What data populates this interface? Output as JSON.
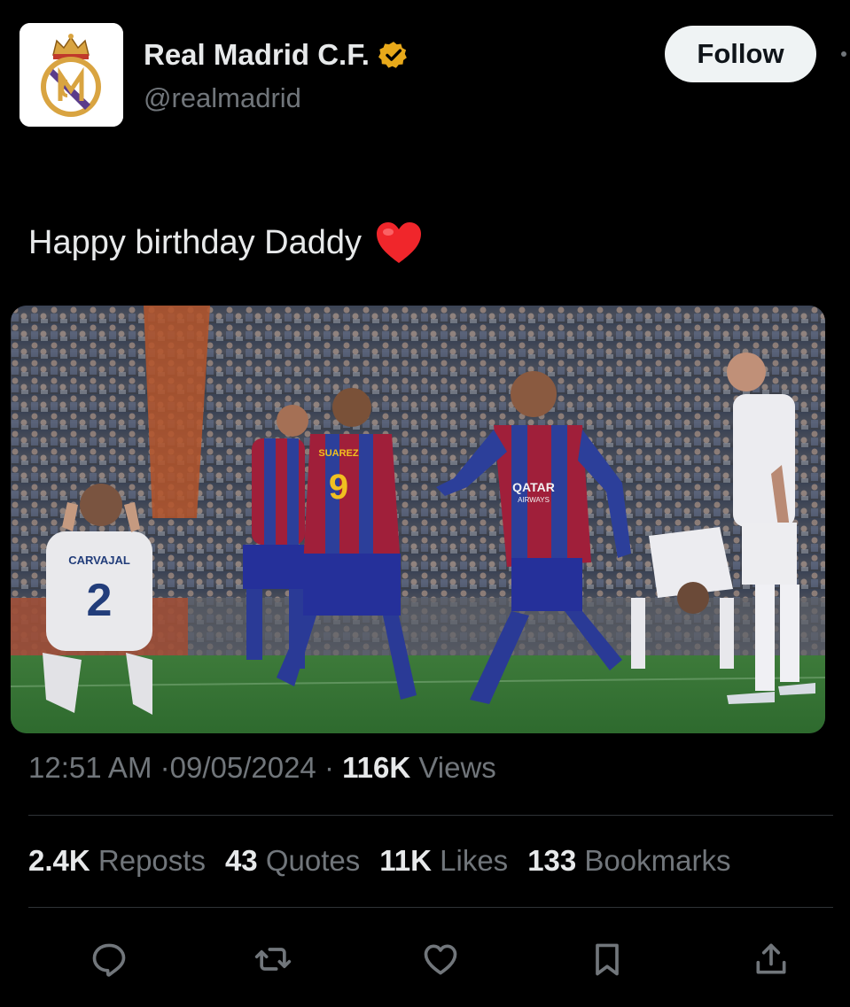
{
  "account": {
    "display_name": "Real Madrid C.F.",
    "handle": "@realmadrid",
    "verified_color": "#e8a91a",
    "avatar": "real-madrid-crest-icon"
  },
  "header": {
    "follow_label": "Follow"
  },
  "tweet": {
    "text": "Happy birthday Daddy",
    "emoji": "red-heart"
  },
  "media": {
    "shirt_texts": [
      "CARVAJAL",
      "2",
      "SUAREZ",
      "9",
      "QATAR",
      "AIRWAYS"
    ]
  },
  "meta": {
    "time": "12:51 AM",
    "date": "09/05/2024",
    "views_count": "116K",
    "views_label": "Views",
    "separator": "·"
  },
  "stats": [
    {
      "count": "2.4K",
      "label": "Reposts"
    },
    {
      "count": "43",
      "label": "Quotes"
    },
    {
      "count": "11K",
      "label": "Likes"
    },
    {
      "count": "133",
      "label": "Bookmarks"
    }
  ],
  "actions": [
    "reply-icon",
    "repost-icon",
    "like-icon",
    "bookmark-icon",
    "share-icon"
  ]
}
